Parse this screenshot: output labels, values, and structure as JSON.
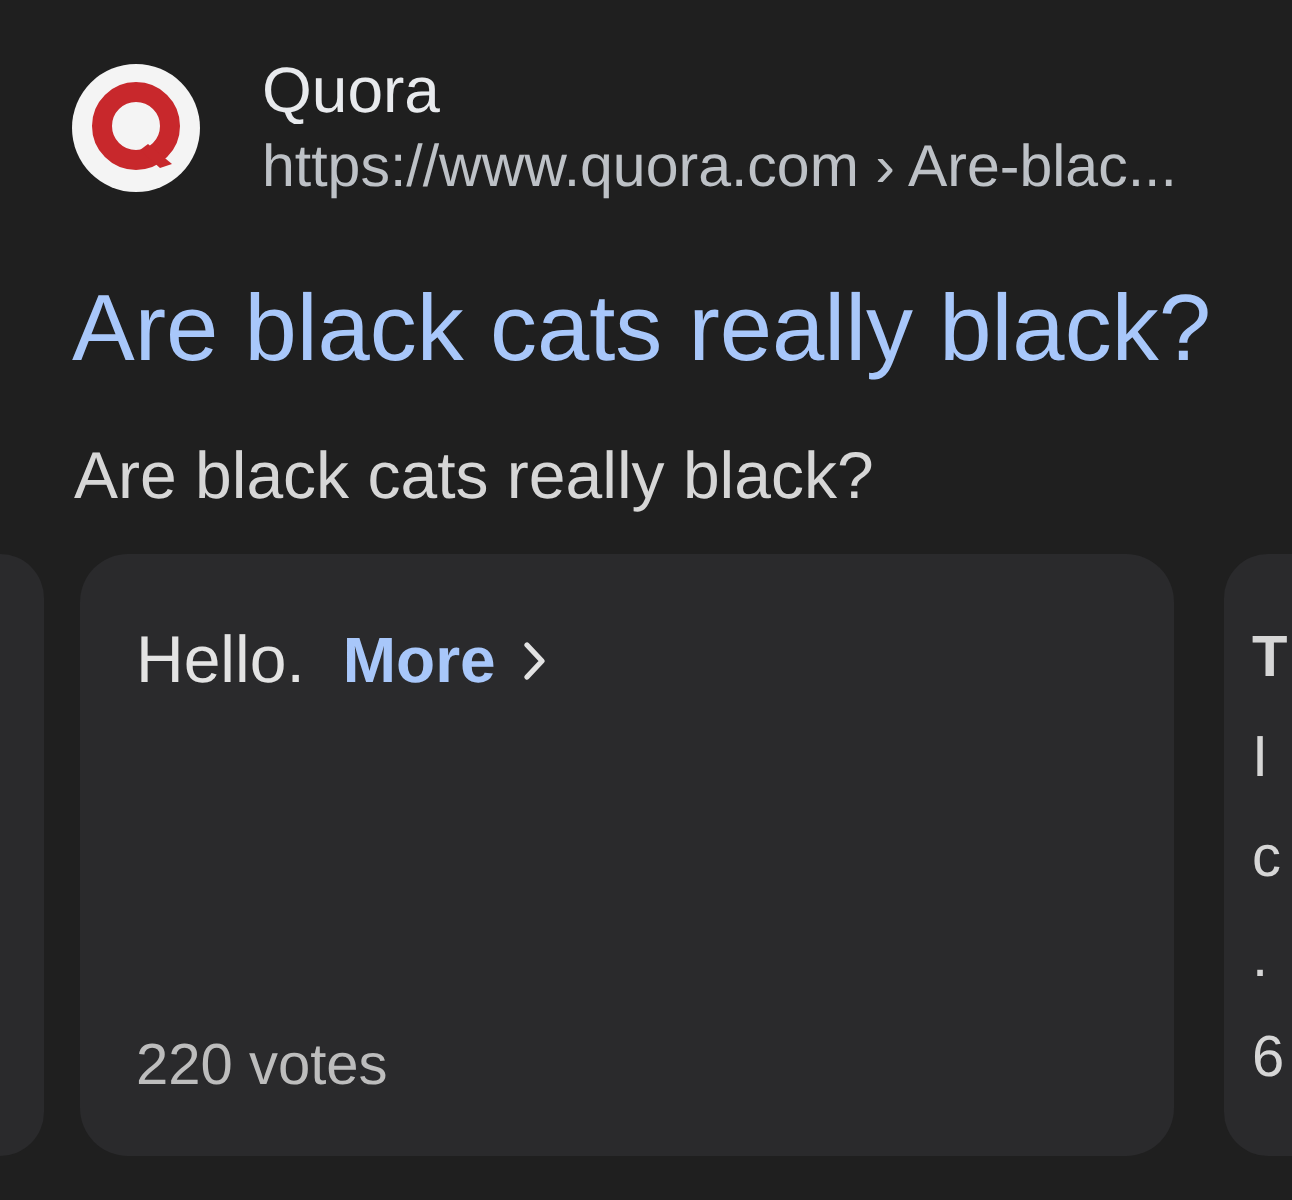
{
  "result": {
    "source": "Quora",
    "url": "https://www.quora.com › Are-blac...",
    "title": "Are black cats really black?",
    "snippet": "Are black cats really black?"
  },
  "answer_card": {
    "text": "Hello.",
    "more_link": "More",
    "votes": "220 votes"
  },
  "next_card": {
    "title": "T",
    "lines": [
      "I",
      "c",
      "."
    ],
    "votes": "6"
  }
}
